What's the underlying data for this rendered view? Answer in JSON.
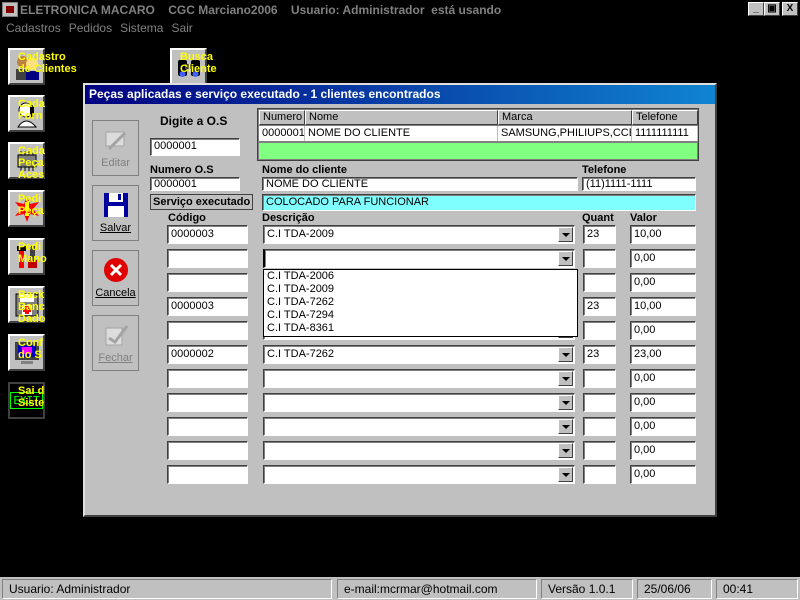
{
  "window": {
    "title": "ELETRONICA MACARO    CGC Marciano2006    Usuario: Administrador  está usando",
    "min_label": "_",
    "max_label": "▣",
    "close_label": "X"
  },
  "menu": {
    "items": [
      {
        "label": "Cadastros"
      },
      {
        "label": "Pedidos"
      },
      {
        "label": "Sistema"
      },
      {
        "label": "Sair"
      }
    ]
  },
  "launchers": [
    {
      "label": "Cadastro\nde Clientes",
      "icon": "people-icon"
    },
    {
      "label": "Busca\nCliente",
      "icon": "binoculars-icon"
    },
    {
      "label": "Cada\nForn",
      "icon": "phone-person-icon"
    },
    {
      "label": "Cada\nPeça\nAces",
      "icon": "chip-icon"
    },
    {
      "label": "Pedi\nPeça",
      "icon": "alert-icon"
    },
    {
      "label": "Pedi\nMano",
      "icon": "tools-icon"
    },
    {
      "label": "Back\nBanc\nDado",
      "icon": "disk-icon"
    },
    {
      "label": "Conf\ndo S",
      "icon": "monitor-icon"
    },
    {
      "label": "Sai d\nSiste",
      "icon": "exit-icon"
    }
  ],
  "exit_icon_text": "EXIT",
  "modal": {
    "title": "Peças aplicadas e serviço executado - 1 clientes encontrados",
    "side_buttons": {
      "editar": "Editar",
      "salvar": "Salvar",
      "cancela": "Cancela",
      "fechar": "Fechar"
    },
    "digite_label": "Digite a O.S",
    "os_input": "0000001",
    "grid": {
      "headers": [
        "Numero",
        "Nome",
        "Marca",
        "Telefone"
      ],
      "row": [
        "0000001",
        "NOME DO CLIENTE",
        "SAMSUNG,PHILIUPS,CCE",
        "1111111111"
      ]
    },
    "numero_os_label": "Numero O.S",
    "numero_os_value": "0000001",
    "nome_cliente_label": "Nome do cliente",
    "nome_cliente_value": "NOME DO CLIENTE",
    "telefone_label": "Telefone",
    "telefone_value": "(11)1111-1111",
    "servico_label": "Serviço executado",
    "servico_value": "COLOCADO PARA FUNCIONAR",
    "col_codigo": "Código",
    "col_descricao": "Descrição",
    "col_quant": "Quant",
    "col_valor": "Valor",
    "rows": [
      {
        "codigo": "0000003",
        "descricao": "C.I TDA-2009",
        "quant": "23",
        "valor": "10,00"
      },
      {
        "codigo": "",
        "descricao": "",
        "quant": "",
        "valor": "0,00"
      },
      {
        "codigo": "",
        "descricao": "",
        "quant": "",
        "valor": "0,00"
      },
      {
        "codigo": "0000003",
        "descricao": "",
        "quant": "23",
        "valor": "10,00"
      },
      {
        "codigo": "",
        "descricao": "",
        "quant": "",
        "valor": "0,00"
      },
      {
        "codigo": "0000002",
        "descricao": "C.I TDA-7262",
        "quant": "23",
        "valor": "23,00"
      },
      {
        "codigo": "",
        "descricao": "",
        "quant": "",
        "valor": "0,00"
      },
      {
        "codigo": "",
        "descricao": "",
        "quant": "",
        "valor": "0,00"
      },
      {
        "codigo": "",
        "descricao": "",
        "quant": "",
        "valor": "0,00"
      },
      {
        "codigo": "",
        "descricao": "",
        "quant": "",
        "valor": "0,00"
      },
      {
        "codigo": "",
        "descricao": "",
        "quant": "",
        "valor": "0,00"
      }
    ],
    "dropdown_options": [
      "C.I TDA-2006",
      "C.I TDA-2009",
      "C.I TDA-7262",
      "C.I TDA-7294",
      "C.I TDA-8361"
    ]
  },
  "status": {
    "user": "Usuario: Administrador",
    "email": "e-mail:mcrmar@hotmail.com",
    "version": "Versão 1.0.1",
    "date": "25/06/06",
    "time": "00:41"
  },
  "colors": {
    "launcher_text": "#ffff00",
    "grid_highlight": "#80ff80",
    "service_field": "#80ffff",
    "modal_title": "#000080"
  }
}
